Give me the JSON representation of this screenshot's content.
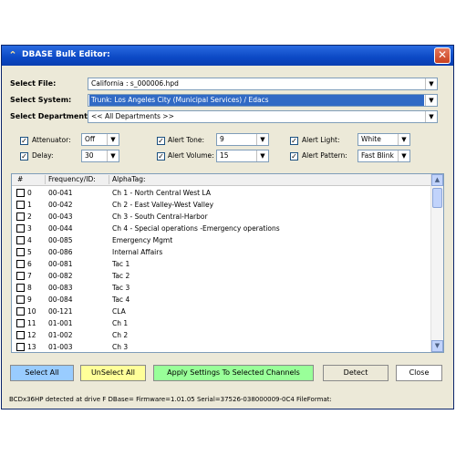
{
  "window": {
    "title": "DBASE Bulk Editor:",
    "close_glyph": "✕"
  },
  "fields": {
    "file_label": "Select File:",
    "file_value": "California : s_000006.hpd",
    "system_label": "Select System:",
    "system_value": "Trunk: Los Angeles City (Municipal Services) / Edacs",
    "department_label": "Select Department:",
    "department_value": "<< All Departments >>"
  },
  "options": {
    "attenuator": {
      "label": "Attenuator:",
      "value": "Off",
      "checked": true
    },
    "delay": {
      "label": "Delay:",
      "value": "30",
      "checked": true
    },
    "alert_tone": {
      "label": "Alert Tone:",
      "value": "9",
      "checked": true
    },
    "alert_volume": {
      "label": "Alert Volume:",
      "value": "15",
      "checked": true
    },
    "alert_light": {
      "label": "Alert Light:",
      "value": "White",
      "checked": true
    },
    "alert_pattern": {
      "label": "Alert Pattern:",
      "value": "Fast Blink",
      "checked": true
    }
  },
  "list": {
    "headers": {
      "num": "#",
      "freq": "Frequency/ID:",
      "tag": "AlphaTag:"
    },
    "rows": [
      {
        "num": "0",
        "freq": "00-041",
        "tag": "Ch 1 - North Central West LA"
      },
      {
        "num": "1",
        "freq": "00-042",
        "tag": "Ch 2 - East Valley-West Valley"
      },
      {
        "num": "2",
        "freq": "00-043",
        "tag": "Ch 3 -  South Central-Harbor"
      },
      {
        "num": "3",
        "freq": "00-044",
        "tag": "Ch 4 - Special operations -Emergency operations"
      },
      {
        "num": "4",
        "freq": "00-085",
        "tag": "Emergency Mgmt"
      },
      {
        "num": "5",
        "freq": "00-086",
        "tag": "Internal Affairs"
      },
      {
        "num": "6",
        "freq": "00-081",
        "tag": "Tac 1"
      },
      {
        "num": "7",
        "freq": "00-082",
        "tag": "Tac 2"
      },
      {
        "num": "8",
        "freq": "00-083",
        "tag": "Tac 3"
      },
      {
        "num": "9",
        "freq": "00-084",
        "tag": "Tac 4"
      },
      {
        "num": "10",
        "freq": "00-121",
        "tag": "CLA"
      },
      {
        "num": "11",
        "freq": "01-001",
        "tag": "Ch 1"
      },
      {
        "num": "12",
        "freq": "01-002",
        "tag": "Ch 2"
      },
      {
        "num": "13",
        "freq": "01-003",
        "tag": "Ch 3"
      }
    ]
  },
  "buttons": {
    "select_all": "Select All",
    "unselect_all": "UnSelect All",
    "apply": "Apply Settings To Selected Channels",
    "detect": "Detect",
    "close": "Close"
  },
  "status": "BCDx36HP detected at drive F DBase= Firmware=1.01.05  Serial=37526-038000009-0C4 FileFormat:",
  "colors": {
    "select_all_bg": "#99ccff",
    "unselect_all_bg": "#ffff99",
    "apply_bg": "#99ff99",
    "selection_bg": "#316ac5"
  }
}
